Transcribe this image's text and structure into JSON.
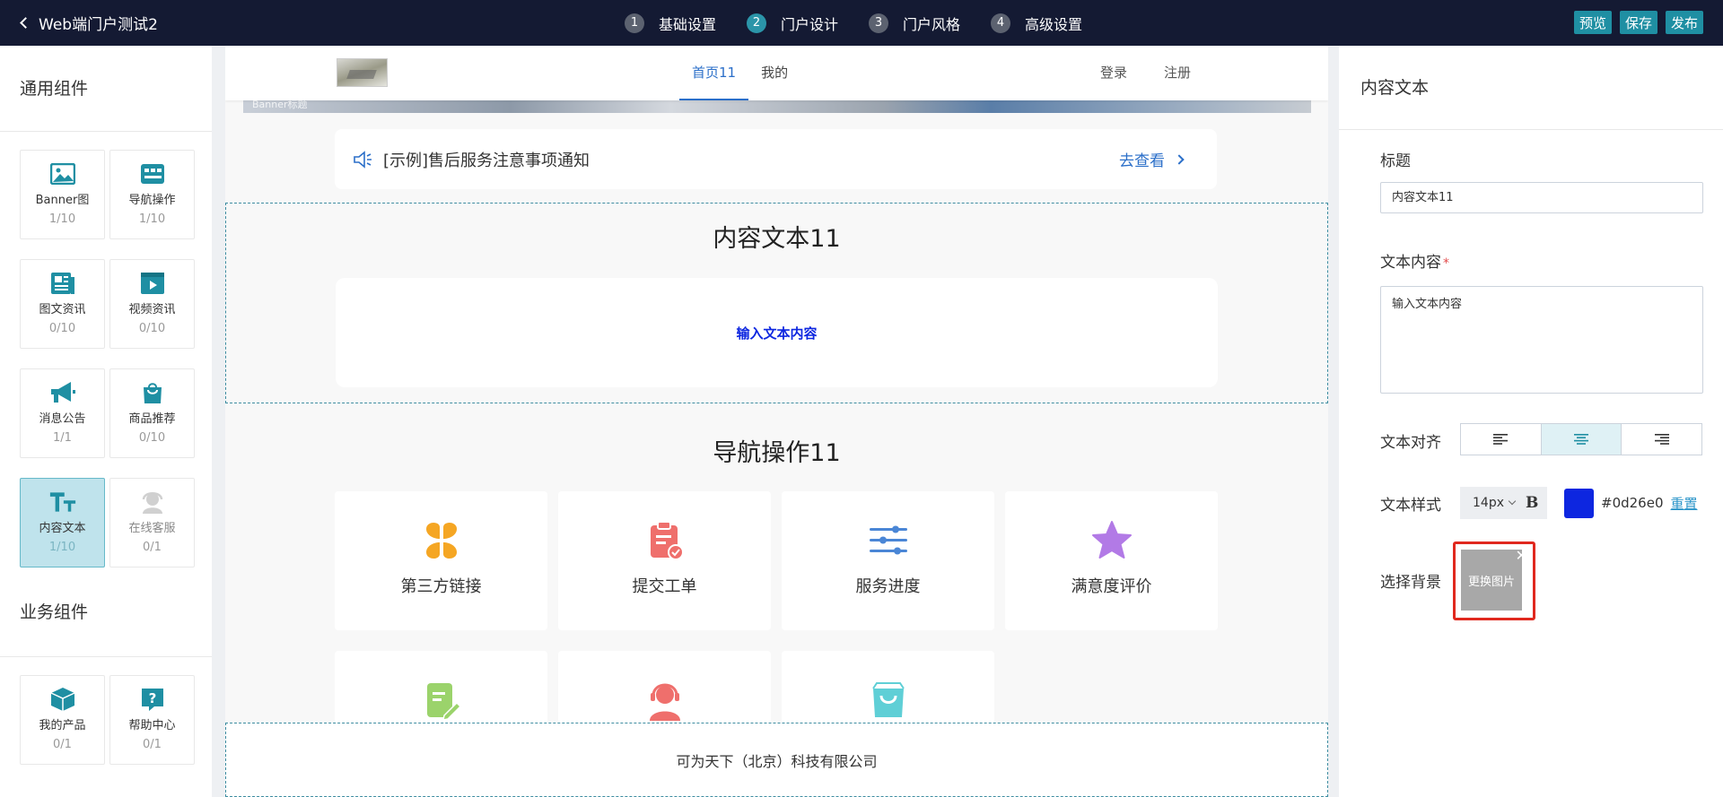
{
  "topbar": {
    "back_title": "Web端门户测试2",
    "steps": [
      {
        "num": "1",
        "label": "基础设置"
      },
      {
        "num": "2",
        "label": "门户设计"
      },
      {
        "num": "3",
        "label": "门户风格"
      },
      {
        "num": "4",
        "label": "高级设置"
      }
    ],
    "active_step": 2,
    "buttons": {
      "preview": "预览",
      "save": "保存",
      "publish": "发布"
    }
  },
  "left": {
    "general_title": "通用组件",
    "general": [
      {
        "label": "Banner图",
        "count": "1/10",
        "icon": "image-icon"
      },
      {
        "label": "导航操作",
        "count": "1/10",
        "icon": "nav-grid-icon"
      },
      {
        "label": "图文资讯",
        "count": "0/10",
        "icon": "article-icon"
      },
      {
        "label": "视频资讯",
        "count": "0/10",
        "icon": "video-icon"
      },
      {
        "label": "消息公告",
        "count": "1/1",
        "icon": "megaphone-icon"
      },
      {
        "label": "商品推荐",
        "count": "0/10",
        "icon": "shopping-bag-icon"
      },
      {
        "label": "内容文本",
        "count": "1/10",
        "icon": "text-icon"
      },
      {
        "label": "在线客服",
        "count": "0/1",
        "icon": "support-agent-icon"
      }
    ],
    "business_title": "业务组件",
    "business": [
      {
        "label": "我的产品",
        "count": "0/1",
        "icon": "box-icon"
      },
      {
        "label": "帮助中心",
        "count": "0/1",
        "icon": "help-icon"
      }
    ]
  },
  "canvas": {
    "nav": [
      "首页11",
      "我的"
    ],
    "auth": {
      "login": "登录",
      "register": "注册"
    },
    "banner_caption": "Banner标题",
    "notice": {
      "text": "[示例]售后服务注意事项通知",
      "link": "去查看"
    },
    "content_block": {
      "title": "内容文本11",
      "text": "输入文本内容"
    },
    "nav_block": {
      "title": "导航操作11",
      "items": [
        "第三方链接",
        "提交工单",
        "服务进度",
        "满意度评价"
      ]
    },
    "footer": "可为天下（北京）科技有限公司"
  },
  "right": {
    "title": "内容文本",
    "title_label": "标题",
    "title_value": "内容文本11",
    "content_label": "文本内容",
    "content_required": "*",
    "content_value": "输入文本内容",
    "align_label": "文本对齐",
    "align_active": "center",
    "style_label": "文本样式",
    "font_size": "14px",
    "bold": "B",
    "color": "#0d26e0",
    "color_text": "#0d26e0",
    "reset": "重置",
    "bg_label": "选择背景",
    "bg_change": "更换图片",
    "bg_close": "✕"
  },
  "colors": {
    "topbar": "#141a33",
    "accent": "#1f8fa3",
    "link": "#2b6fc9",
    "text_color": "#0d26e0",
    "highlight_border": "#e0281e"
  }
}
